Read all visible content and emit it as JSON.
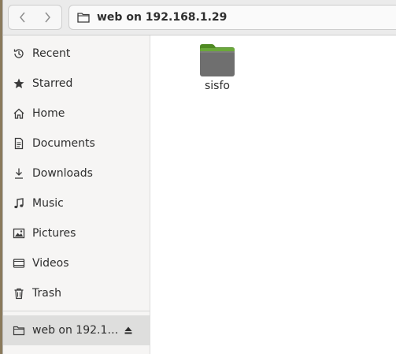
{
  "header": {
    "location": "web on 192.168.1.29",
    "icons": {
      "back": "chevron-left-icon",
      "forward": "chevron-right-icon",
      "location": "folder-icon"
    }
  },
  "sidebar": {
    "items": [
      {
        "label": "Recent",
        "icon": "clock-icon"
      },
      {
        "label": "Starred",
        "icon": "star-icon"
      },
      {
        "label": "Home",
        "icon": "home-icon"
      },
      {
        "label": "Documents",
        "icon": "document-icon"
      },
      {
        "label": "Downloads",
        "icon": "download-icon"
      },
      {
        "label": "Music",
        "icon": "music-icon"
      },
      {
        "label": "Pictures",
        "icon": "picture-icon"
      },
      {
        "label": "Videos",
        "icon": "video-icon"
      },
      {
        "label": "Trash",
        "icon": "trash-icon"
      }
    ],
    "mount": {
      "label": "web on 192.1…",
      "icon": "folder-icon",
      "action_icon": "eject-icon"
    }
  },
  "content": {
    "files": [
      {
        "name": "sisfo",
        "type": "folder"
      }
    ]
  },
  "colors": {
    "folder_green": "#5b9a2c",
    "folder_gray": "#6e6e6e",
    "sidebar_bg": "#f6f5f4",
    "active_bg": "#dededd"
  }
}
